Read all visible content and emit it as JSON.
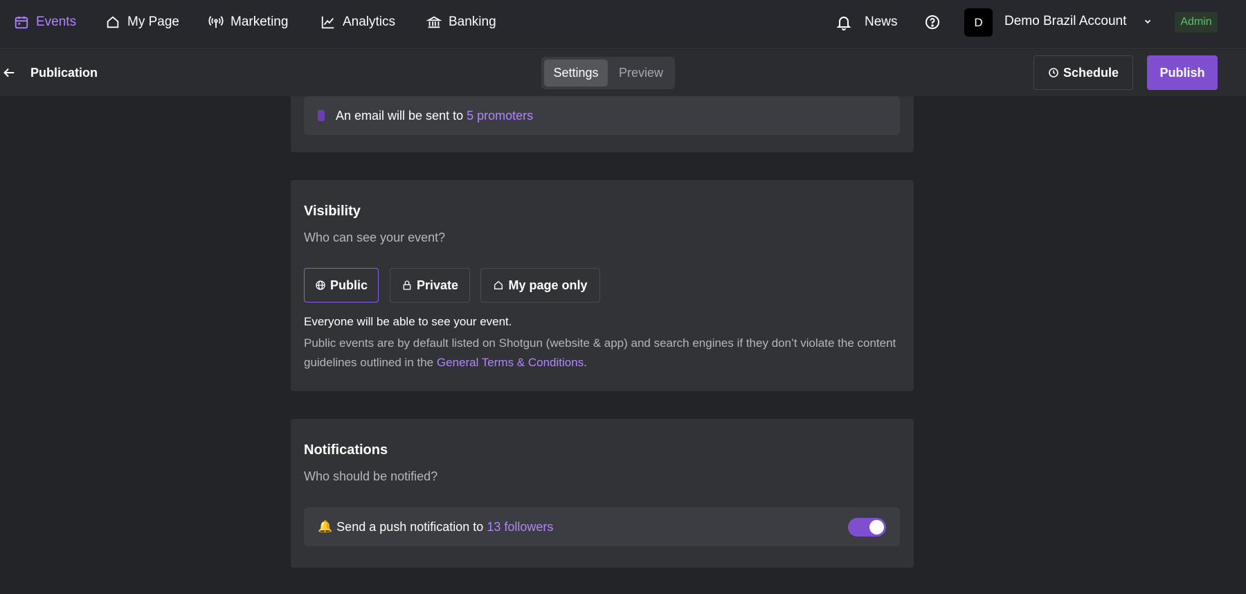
{
  "nav": {
    "items": [
      {
        "label": "Events",
        "icon": "calendar-icon",
        "active": true
      },
      {
        "label": "My Page",
        "icon": "home-icon"
      },
      {
        "label": "Marketing",
        "icon": "broadcast-icon"
      },
      {
        "label": "Analytics",
        "icon": "line-chart-icon"
      },
      {
        "label": "Banking",
        "icon": "bank-icon"
      }
    ],
    "news_label": "News",
    "account": {
      "initial": "D",
      "name": "Demo Brazil Account",
      "badge": "Admin"
    }
  },
  "subheader": {
    "title": "Publication",
    "tabs": {
      "settings": "Settings",
      "preview": "Preview"
    },
    "schedule_label": "Schedule",
    "publish_label": "Publish"
  },
  "email_notice": {
    "text": "An email will be sent to",
    "link": "5 promoters"
  },
  "visibility": {
    "title": "Visibility",
    "subtitle": "Who can see your event?",
    "options": {
      "public": "Public",
      "private": "Private",
      "my_page": "My page only"
    },
    "selected": "Public",
    "description": "Everyone will be able to see your event.",
    "note_text": "Public events are by default listed on Shotgun (website & app) and search engines if they don’t violate the content guidelines outlined in the",
    "note_link": "General Terms & Conditions",
    "note_end": "."
  },
  "notifications": {
    "title": "Notifications",
    "subtitle": "Who should be notified?",
    "push_icon": "🔔",
    "push_text": "Send a push notification to",
    "push_link": "13 followers",
    "push_enabled": true
  },
  "colors": {
    "accent": "#b184ff",
    "primary": "#7f4fd0",
    "admin": "#5bc26a"
  }
}
